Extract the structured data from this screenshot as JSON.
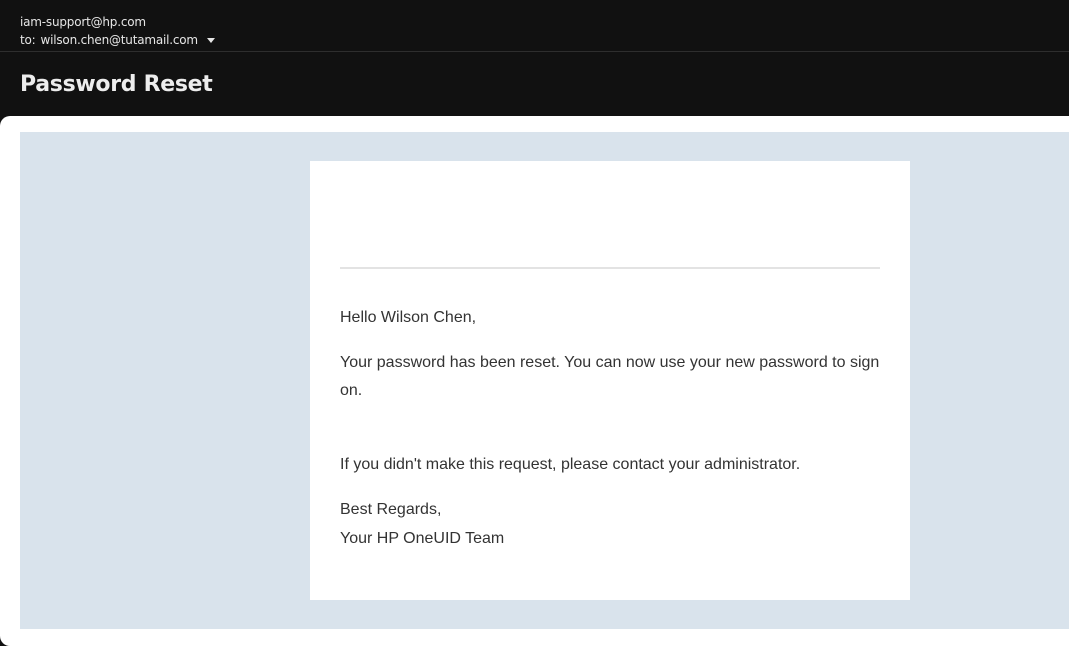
{
  "email": {
    "from": "iam-support@hp.com",
    "to_label": "to:",
    "to_address": "wilson.chen@tutamail.com",
    "subject": "Password Reset"
  },
  "message": {
    "greeting": "Hello Wilson Chen,",
    "body": "Your password has been reset. You can now use your new password to sign on.",
    "admin_note": "If you didn't make this request, please contact your administrator.",
    "closing": "Best Regards,",
    "signature": "Your HP OneUID Team"
  },
  "icons": {
    "recipients_toggle": "chevron-down-icon"
  },
  "colors": {
    "header_bg": "#111111",
    "mail_bg": "#d9e3ec",
    "card_bg": "#ffffff",
    "text": "#333333"
  }
}
